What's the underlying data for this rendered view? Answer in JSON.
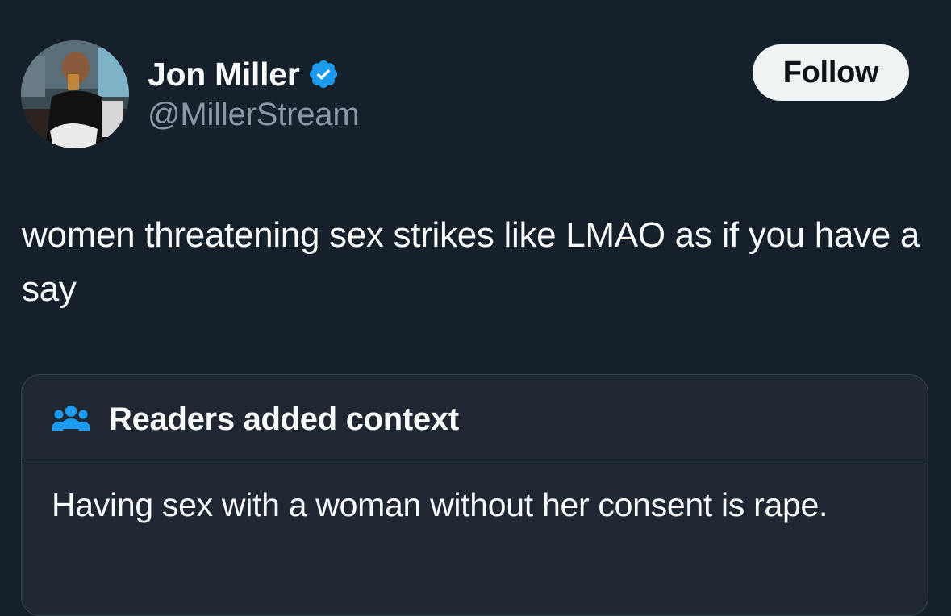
{
  "author": {
    "display_name": "Jon Miller",
    "handle": "@MillerStream",
    "verified_icon": "verified-badge-icon",
    "avatar": "avatar-photo"
  },
  "actions": {
    "follow_label": "Follow"
  },
  "tweet": {
    "text": "women threatening sex strikes like LMAO as if you have a say"
  },
  "community_note": {
    "icon": "people-icon",
    "title": "Readers added context",
    "body": "Having sex with a woman without her consent is rape."
  },
  "colors": {
    "background": "#15202b",
    "card_background": "#1e2732",
    "verified_blue": "#1d9bf0",
    "secondary_text": "#8b98a5",
    "follow_button_bg": "#eff3f4"
  }
}
